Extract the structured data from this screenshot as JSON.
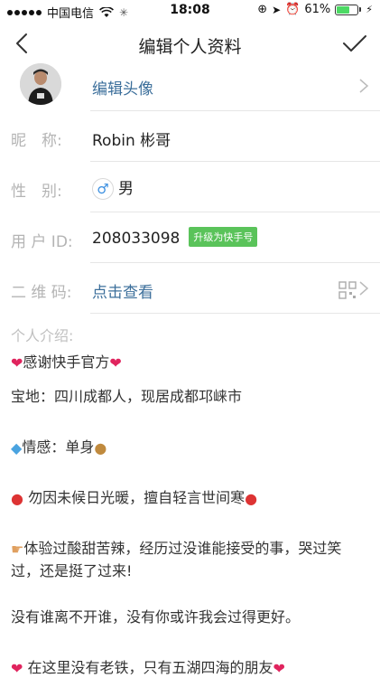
{
  "status_bar": {
    "carrier": "中国电信",
    "time": "18:08",
    "battery_percent": "61%",
    "battery_level": 0.61
  },
  "nav": {
    "title": "编辑个人资料",
    "back_icon": "chevron-left-icon",
    "confirm_icon": "checkmark-icon"
  },
  "profile": {
    "edit_avatar_label": "编辑头像",
    "nickname_label": "昵　称:",
    "nickname": "Robin 彬哥",
    "gender_label": "性　别:",
    "gender_symbol": "♂",
    "gender": "男",
    "uid_label": "用 户 ID:",
    "uid": "208033098",
    "upgrade_badge": "升级为快手号",
    "qr_label": "二 维 码:",
    "qr_link": "点击查看"
  },
  "intro": {
    "label": "个人介绍:",
    "lines": [
      "感谢快手官方",
      "宝地：四川成都人，现居成都邛崃市",
      "情感：单身",
      "勿因未候日光暖，擅自轻言世间寒",
      "体验过酸甜苦辣，经历过没谁能接受的事，哭过笑",
      "过，还是挺了过来!",
      "没有谁离不开谁，没有你或许我会过得更好。",
      "在这里没有老铁，只有五湖四海的朋友"
    ]
  },
  "colors": {
    "accent_link": "#3c6f9b",
    "badge_green": "#5ac35a",
    "label_gray": "#b4b4b4"
  }
}
